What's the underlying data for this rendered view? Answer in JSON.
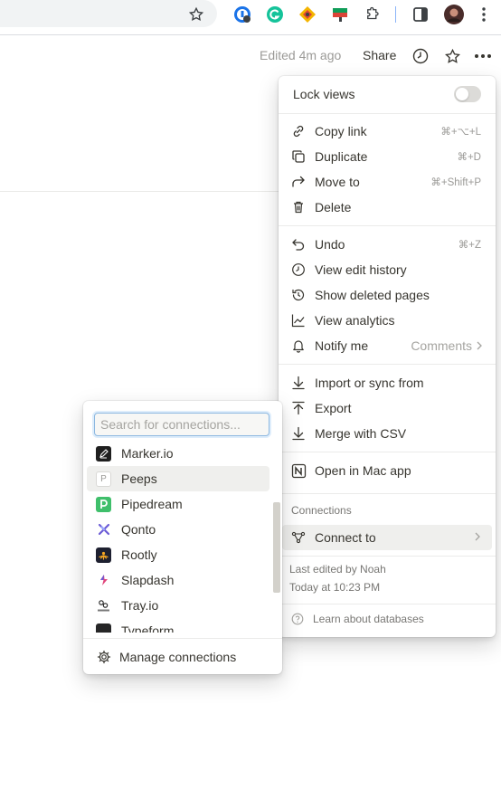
{
  "browser": {
    "extensions": [
      "bookmark-star-icon",
      "password-manager-extension-icon",
      "grammarly-extension-icon",
      "diamond-extension-icon",
      "flag-extension-icon",
      "puzzle-extensions-icon",
      "side-panel-icon",
      "profile-avatar",
      "kebab-menu-icon"
    ]
  },
  "topbar": {
    "edited": "Edited 4m ago",
    "share": "Share"
  },
  "menu": {
    "lock_views": "Lock views",
    "lock_views_on": false,
    "group1": [
      {
        "label": "Copy link",
        "shortcut": "⌘+⌥+L",
        "icon": "link-icon"
      },
      {
        "label": "Duplicate",
        "shortcut": "⌘+D",
        "icon": "duplicate-icon"
      },
      {
        "label": "Move to",
        "shortcut": "⌘+Shift+P",
        "icon": "move-arrow-icon"
      },
      {
        "label": "Delete",
        "shortcut": "",
        "icon": "trash-icon"
      }
    ],
    "group2": [
      {
        "label": "Undo",
        "shortcut": "⌘+Z",
        "icon": "undo-icon"
      },
      {
        "label": "View edit history",
        "shortcut": "",
        "icon": "clock-icon"
      },
      {
        "label": "Show deleted pages",
        "shortcut": "",
        "icon": "restore-icon"
      },
      {
        "label": "View analytics",
        "shortcut": "",
        "icon": "analytics-icon"
      },
      {
        "label": "Notify me",
        "shortcut": "Comments",
        "icon": "bell-icon"
      }
    ],
    "group3": [
      {
        "label": "Import or sync from",
        "icon": "download-icon"
      },
      {
        "label": "Export",
        "icon": "upload-icon"
      },
      {
        "label": "Merge with CSV",
        "icon": "download-icon"
      }
    ],
    "open_mac": "Open in Mac app",
    "connections_header": "Connections",
    "connect_to": "Connect to",
    "last_edited_by": "Last edited by Noah",
    "last_edited_time": "Today at 10:23 PM",
    "learn": "Learn about databases"
  },
  "connections": {
    "search_placeholder": "Search for connections...",
    "items": [
      {
        "label": "Marker.io"
      },
      {
        "label": "Peeps"
      },
      {
        "label": "Pipedream"
      },
      {
        "label": "Qonto"
      },
      {
        "label": "Rootly"
      },
      {
        "label": "Slapdash"
      },
      {
        "label": "Tray.io"
      },
      {
        "label": "Typeform"
      }
    ],
    "manage": "Manage connections"
  },
  "colors": {
    "text": "#37352f",
    "muted": "#9b9a97",
    "hover": "#efefed",
    "pipedream": "#3fbf6b",
    "qonto": "#6b5bd6"
  }
}
